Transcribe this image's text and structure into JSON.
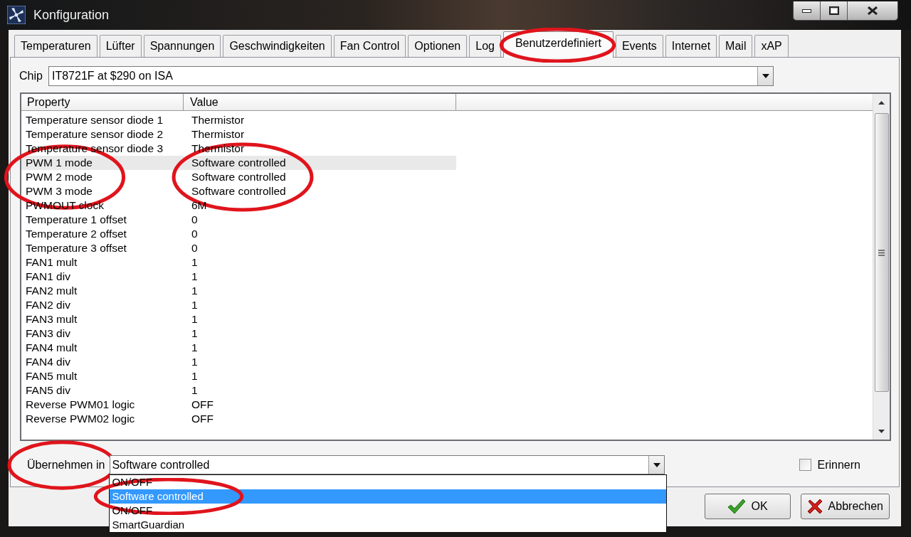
{
  "window": {
    "title": "Konfiguration"
  },
  "tabs": [
    {
      "label": "Temperaturen",
      "selected": false,
      "circled": false
    },
    {
      "label": "Lüfter",
      "selected": false,
      "circled": false
    },
    {
      "label": "Spannungen",
      "selected": false,
      "circled": false
    },
    {
      "label": "Geschwindigkeiten",
      "selected": false,
      "circled": false
    },
    {
      "label": "Fan Control",
      "selected": false,
      "circled": false
    },
    {
      "label": "Optionen",
      "selected": false,
      "circled": false
    },
    {
      "label": "Log",
      "selected": false,
      "circled": false
    },
    {
      "label": "Benutzerdefiniert",
      "selected": true,
      "circled": true
    },
    {
      "label": "Events",
      "selected": false,
      "circled": false
    },
    {
      "label": "Internet",
      "selected": false,
      "circled": false
    },
    {
      "label": "Mail",
      "selected": false,
      "circled": false
    },
    {
      "label": "xAP",
      "selected": false,
      "circled": false
    }
  ],
  "chip": {
    "label": "Chip",
    "value": "IT8721F at $290 on ISA"
  },
  "list": {
    "columns": [
      "Property",
      "Value"
    ],
    "rows": [
      {
        "property": "Temperature sensor diode 1",
        "value": "Thermistor",
        "selected": false,
        "circled": false
      },
      {
        "property": "Temperature sensor diode 2",
        "value": "Thermistor",
        "selected": false,
        "circled": false
      },
      {
        "property": "Temperature sensor diode 3",
        "value": "Thermistor",
        "selected": false,
        "circled": false
      },
      {
        "property": "PWM 1 mode",
        "value": "Software controlled",
        "selected": true,
        "circled": true
      },
      {
        "property": "PWM 2 mode",
        "value": "Software controlled",
        "selected": false,
        "circled": true
      },
      {
        "property": "PWM 3 mode",
        "value": "Software controlled",
        "selected": false,
        "circled": true
      },
      {
        "property": "PWMOUT clock",
        "value": "6M",
        "selected": false,
        "circled": false
      },
      {
        "property": "Temperature 1 offset",
        "value": "0",
        "selected": false,
        "circled": false
      },
      {
        "property": "Temperature 2 offset",
        "value": "0",
        "selected": false,
        "circled": false
      },
      {
        "property": "Temperature 3 offset",
        "value": "0",
        "selected": false,
        "circled": false
      },
      {
        "property": "FAN1 mult",
        "value": "1",
        "selected": false,
        "circled": false
      },
      {
        "property": "FAN1 div",
        "value": "1",
        "selected": false,
        "circled": false
      },
      {
        "property": "FAN2 mult",
        "value": "1",
        "selected": false,
        "circled": false
      },
      {
        "property": "FAN2 div",
        "value": "1",
        "selected": false,
        "circled": false
      },
      {
        "property": "FAN3 mult",
        "value": "1",
        "selected": false,
        "circled": false
      },
      {
        "property": "FAN3 div",
        "value": "1",
        "selected": false,
        "circled": false
      },
      {
        "property": "FAN4 mult",
        "value": "1",
        "selected": false,
        "circled": false
      },
      {
        "property": "FAN4 div",
        "value": "1",
        "selected": false,
        "circled": false
      },
      {
        "property": "FAN5 mult",
        "value": "1",
        "selected": false,
        "circled": false
      },
      {
        "property": "FAN5 div",
        "value": "1",
        "selected": false,
        "circled": false
      },
      {
        "property": "Reverse PWM01 logic",
        "value": "OFF",
        "selected": false,
        "circled": false
      },
      {
        "property": "Reverse PWM02 logic",
        "value": "OFF",
        "selected": false,
        "circled": false
      }
    ]
  },
  "apply": {
    "label": "Übernehmen in",
    "circled": true,
    "value": "Software controlled",
    "options": [
      {
        "label": "ON/OFF",
        "selected": false,
        "circled": false
      },
      {
        "label": "Software controlled",
        "selected": true,
        "circled": true
      },
      {
        "label": "ON/OFF",
        "selected": false,
        "circled": false
      },
      {
        "label": "SmartGuardian",
        "selected": false,
        "circled": false
      }
    ]
  },
  "remember": {
    "label": "Erinnern",
    "checked": false
  },
  "buttons": [
    {
      "label": "OK",
      "kind": "ok"
    },
    {
      "label": "Abbrechen",
      "kind": "cancel"
    }
  ]
}
